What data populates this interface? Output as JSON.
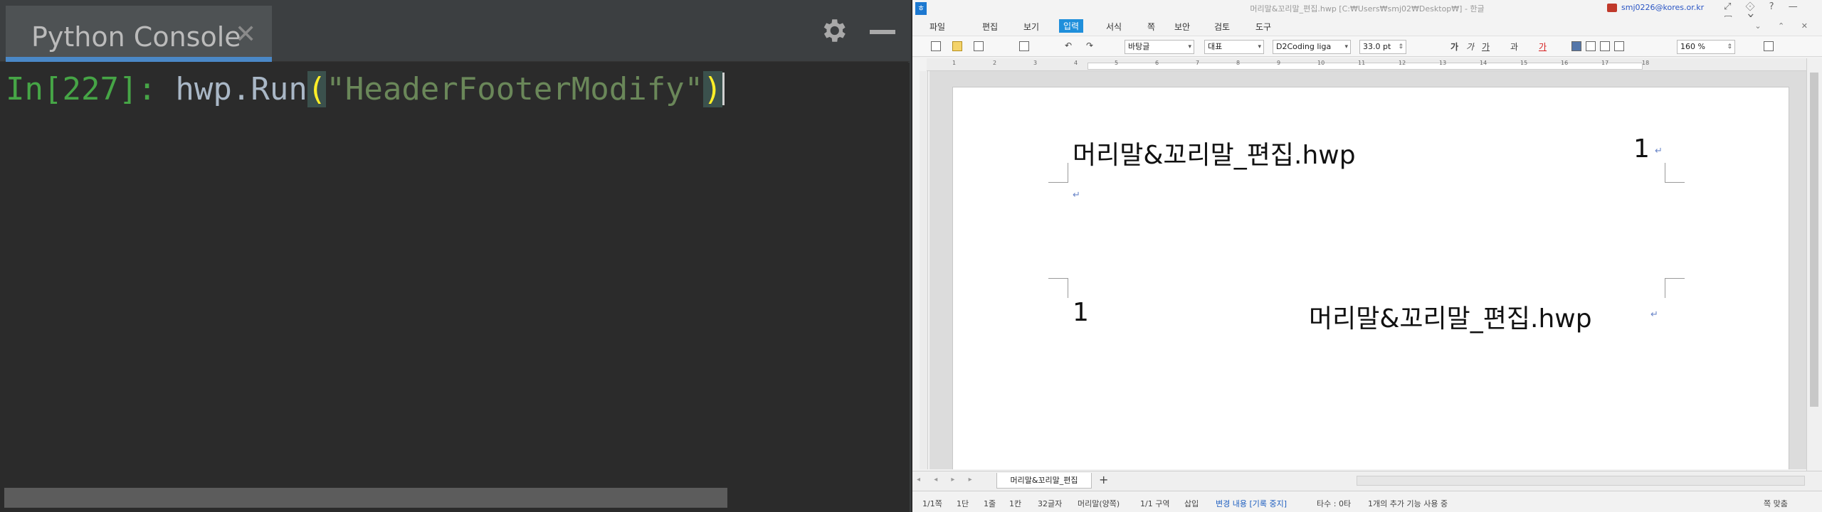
{
  "console": {
    "tab_title": "Python Console",
    "tab_close": "✕",
    "prompt": "In[227]: ",
    "code_ident": "hwp.Run",
    "code_open_paren": "(",
    "code_string": "\"HeaderFooterModify\"",
    "code_close_paren": ")"
  },
  "hwp": {
    "window_title": "머리말&꼬리말_편집.hwp [C:₩Users₩smj02₩Desktop₩] - 한글",
    "user": "smj0226@kores.or.kr",
    "menu": [
      "파일",
      "편집",
      "보기",
      "입력",
      "서식",
      "쪽",
      "보안",
      "검토",
      "도구"
    ],
    "active_menu": "입력",
    "toolbar": {
      "style": "바탕글",
      "lang": "대표",
      "font": "D2Coding liga",
      "size": "33.0",
      "size_unit": "pt",
      "zoom": "160",
      "zoom_unit": "%"
    },
    "ruler_numbers": [
      "1",
      "2",
      "3",
      "4",
      "5",
      "6",
      "7",
      "8",
      "9",
      "10",
      "11",
      "12",
      "13",
      "14",
      "15",
      "16",
      "17",
      "18"
    ],
    "header_text": "머리말&꼬리말_편집.hwp",
    "header_page_no": "1",
    "footer_page_no": "1",
    "footer_text": "머리말&꼬리말_편집.hwp",
    "doc_tab": "머리말&꼬리말_편집",
    "status": {
      "page": "1/1쪽",
      "column": "1단",
      "line": "1줄",
      "col": "1칸",
      "chars": "32글자",
      "area": "머리말(양쪽)",
      "section": "1/1 구역",
      "insert": "삽입",
      "change_tracking": "변경 내용 [기록 중지]",
      "typos": "타수 : 0타",
      "extra": "1개의 추가 기능 사용 중",
      "fit": "쪽 맞춤"
    }
  }
}
